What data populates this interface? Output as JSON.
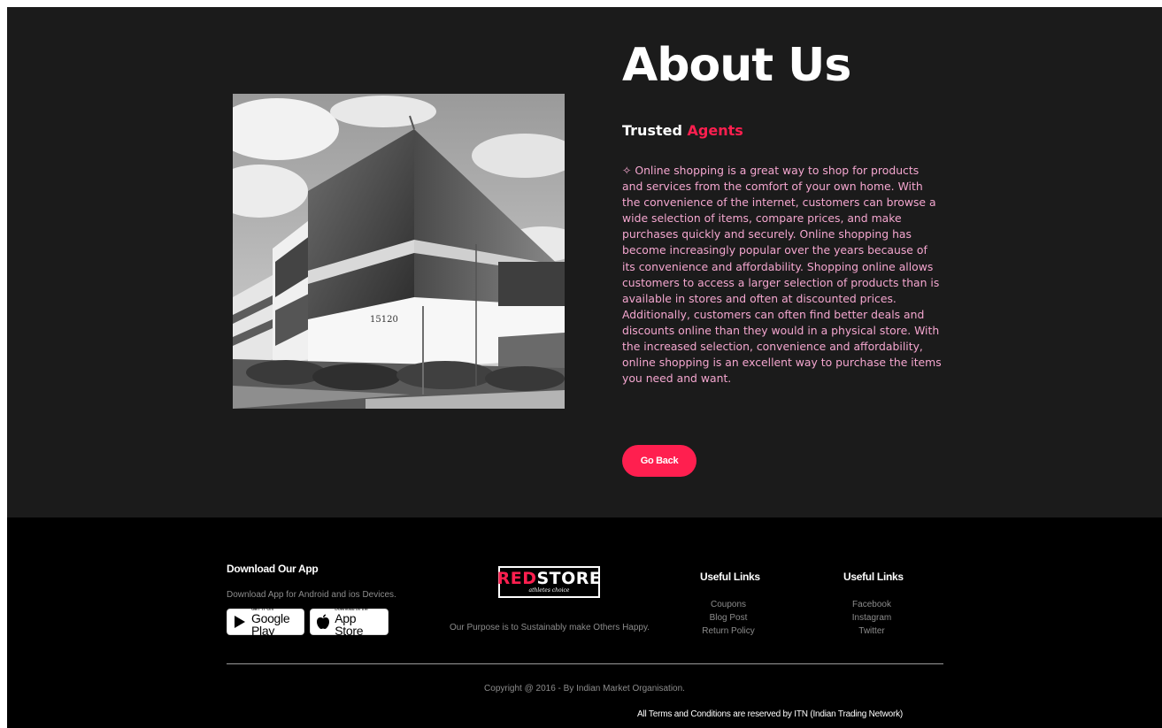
{
  "about": {
    "title": "About Us",
    "subtitle_white": "Trusted",
    "subtitle_red": "Agents",
    "paragraph": "✧ Online shopping is a great way to shop for products and services from the comfort of your own home. With the convenience of the internet, customers can browse a wide selection of items, compare prices, and make purchases quickly and securely. Online shopping has become increasingly popular over the years because of its convenience and affordability. Shopping online allows customers to access a larger selection of products than is available in stores and often at discounted prices. Additionally, customers can often find better deals and discounts online than they would in a physical store. With the increased selection, convenience and affordability, online shopping is an excellent way to purchase the items you need and want.",
    "button_label": "Go Back",
    "building_number": "15120"
  },
  "footer": {
    "app": {
      "title": "Download Our App",
      "text": "Download App for Android and ios Devices.",
      "google_small": "GET IT ON",
      "google_big": "Google Play",
      "apple_small": "Download on the",
      "apple_big": "App Store"
    },
    "logo": {
      "red": "RED",
      "white": "STORE",
      "tagline": "athletes choice"
    },
    "purpose": "Our Purpose is to Sustainably make Others Happy.",
    "links1": {
      "title": "Useful Links",
      "items": [
        "Coupons",
        "Blog Post",
        "Return Policy"
      ]
    },
    "links2": {
      "title": "Useful Links",
      "items": [
        "Facebook",
        "Instagram",
        "Twitter"
      ]
    },
    "copyright": "Copyright @ 2016 - By Indian Market Organisation.",
    "terms": "All Terms and Conditions are reserved by ITN (Indian Trading Network)"
  },
  "colors": {
    "accent": "#ff1f4f",
    "section_bg": "#1b1b1b",
    "footer_bg": "#000000",
    "paragraph": "#f4a6cf"
  }
}
